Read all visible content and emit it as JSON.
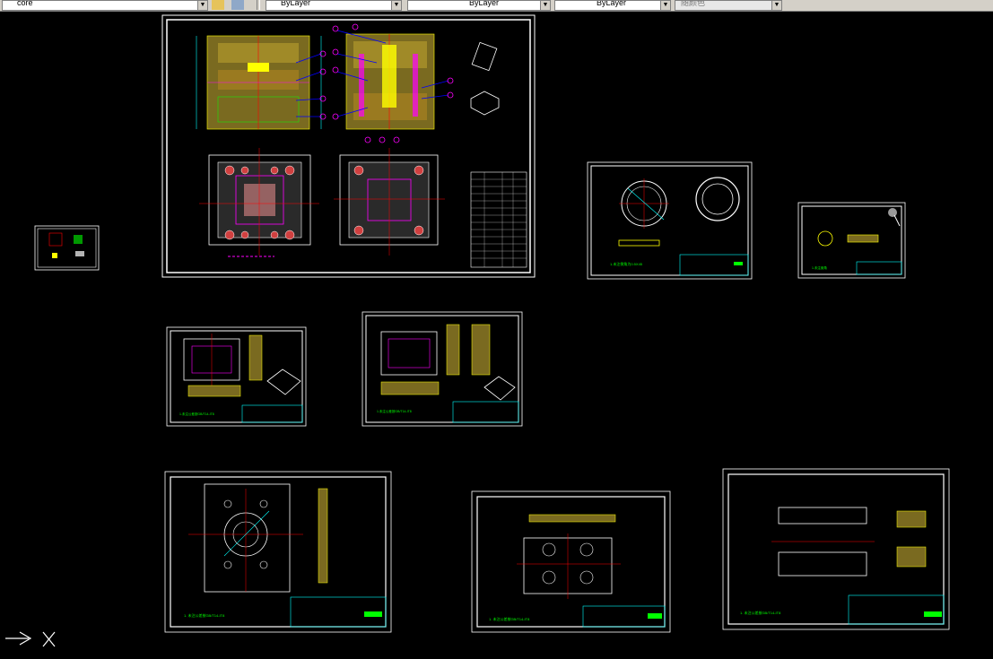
{
  "toolbar": {
    "layer_value": "core",
    "color_value": "ByLayer",
    "linetype_value": "ByLayer",
    "lineweight_value": "ByLayer",
    "plotstyle_value": "随颜色"
  },
  "colors": {
    "background": "#000000",
    "frame": "#ffffff",
    "cyan": "#00ffff",
    "green": "#00ff00",
    "yellow": "#ffff00",
    "red": "#ff0000",
    "magenta": "#ff00ff",
    "blue": "#0000ff"
  },
  "drawings": [
    {
      "name": "assembly-drawing",
      "note": ""
    },
    {
      "name": "small-sheet-thumbnail",
      "note": ""
    },
    {
      "name": "ring-part-drawing",
      "note": "1.未注倒角为0.5X45"
    },
    {
      "name": "small-part-drawing",
      "note": "1.未注倒角"
    },
    {
      "name": "cavity-plate-drawing",
      "note": "1.未注公差按GB/T14-IT8"
    },
    {
      "name": "core-plate-drawing",
      "note": "1.未注公差按GB/T14-IT8"
    },
    {
      "name": "clamp-plate-drawing",
      "note": "1. 未注公差按GB/T14-IT8"
    },
    {
      "name": "support-plate-drawing",
      "note": "1. 未注公差按GB/T14-IT8"
    },
    {
      "name": "ejector-plate-drawing",
      "note": "1. 未注公差按GB/T14-IT8"
    }
  ]
}
